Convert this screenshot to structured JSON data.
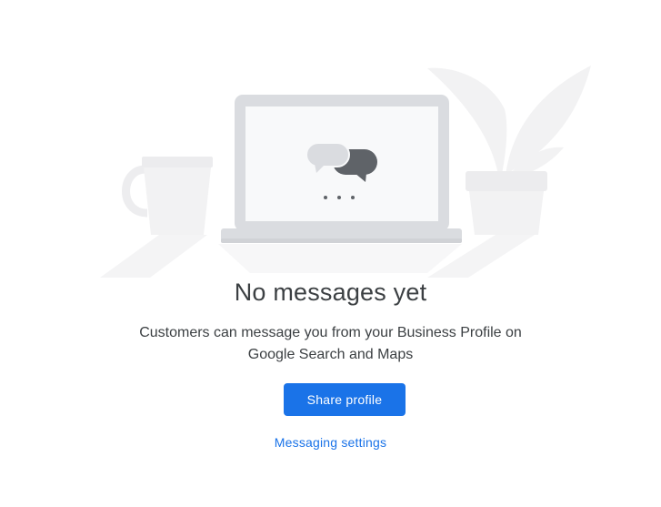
{
  "empty_state": {
    "title": "No messages yet",
    "description_line1": "Customers can message you from your Business Profile on",
    "description_line2": "Google Search and Maps",
    "primary_button_label": "Share profile",
    "secondary_link_label": "Messaging settings"
  },
  "colors": {
    "accent": "#1a73e8",
    "text": "#3c4043",
    "illustration_gray": "#dadce0",
    "illustration_light": "#f1f3f4",
    "bubble_dark": "#5f6368"
  },
  "icons": {
    "illustration": "laptop-chat-illustration",
    "chat": "chat-bubbles-icon"
  }
}
